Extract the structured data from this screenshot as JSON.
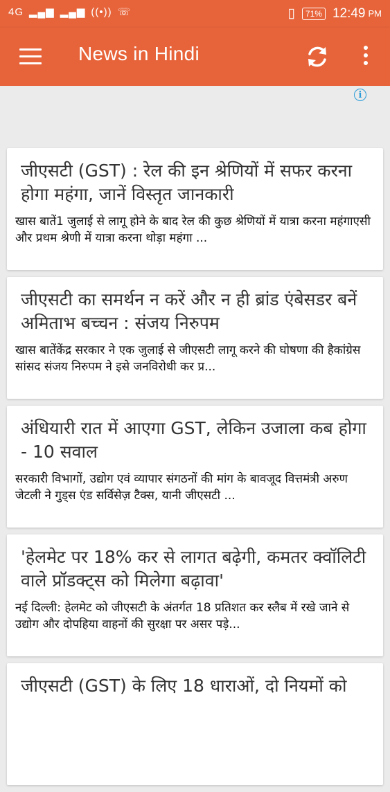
{
  "status_bar": {
    "network": "4G",
    "time": "12:49",
    "ampm": "PM",
    "battery": "71%"
  },
  "app_bar": {
    "title": "News in Hindi",
    "icons": [
      "menu-icon",
      "refresh-icon",
      "more-vert-icon"
    ],
    "color": "#e7643a"
  },
  "ad": {
    "icon": "info-icon"
  },
  "articles": [
    {
      "title": "जीएसटी (GST) : रेल की इन श्रेणियों में सफर करना होगा महंगा, जानें विस्तृत जानकारी",
      "summary": "खास बातें1 जुलाई से लागू होने के बाद रेल की कुछ श्रेणियों में यात्रा करना महंगाएसी और प्रथम श्रेणी में यात्रा करना थोड़ा महंगा ..."
    },
    {
      "title": "जीएसटी का समर्थन न करें और न ही ब्रांड एंबेसडर बनें अमिताभ बच्चन : संजय निरुपम",
      "summary": "खास बातेंकेंद्र सरकार ने एक जुलाई से जीएसटी लागू करने की घोषणा की हैकांग्रेस सांसद संजय निरुपम ने इसे जनविरोधी कर प्र..."
    },
    {
      "title": "अंधियारी रात में आएगा GST, लेकिन उजाला कब होगा - 10 सवाल",
      "summary": "सरकारी विभागों, उद्योग एवं व्यापार संगठनों की मांग के बावजूद वित्तमंत्री अरुण जेटली ने गुड्स एंड सर्विसेज़ टैक्स, यानी जीएसटी ..."
    },
    {
      "title": "'हेलमेट पर 18% कर से लागत बढ़ेगी, कमतर क्वॉलिटी वाले प्रॉडक्ट्स को मिलेगा बढ़ावा'",
      "summary": "नई दिल्ली: हेलमेट को जीएसटी के अंतर्गत 18 प्रतिशत कर स्लैब में रखे जाने से उद्योग और दोपहिया वाहनों की सुरक्षा पर असर पड़े..."
    },
    {
      "title": "जीएसटी (GST) के लिए 18 धाराओं, दो नियमों को",
      "summary": ""
    }
  ]
}
